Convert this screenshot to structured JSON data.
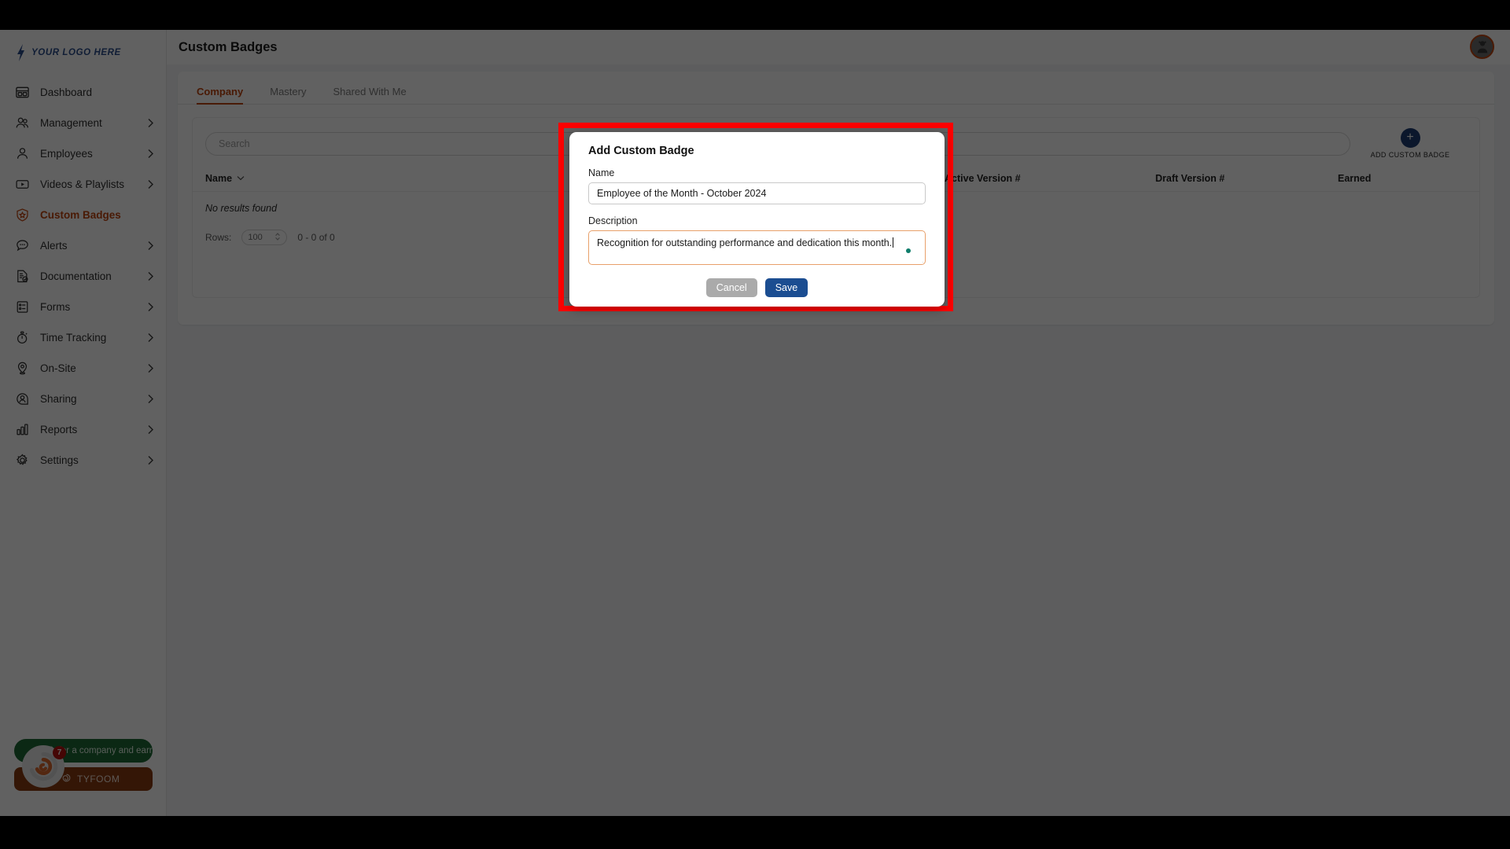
{
  "brand": {
    "logo_text": "YOUR LOGO HERE",
    "accent": "#c1440e",
    "primary_blue": "#1b4d91",
    "logo_blue": "#2b4d8c"
  },
  "sidebar": {
    "items": [
      {
        "label": "Dashboard",
        "icon": "dashboard-icon",
        "chevron": false,
        "active": false
      },
      {
        "label": "Management",
        "icon": "people-icon",
        "chevron": true,
        "active": false
      },
      {
        "label": "Employees",
        "icon": "person-icon",
        "chevron": true,
        "active": false
      },
      {
        "label": "Videos & Playlists",
        "icon": "video-icon",
        "chevron": true,
        "active": false
      },
      {
        "label": "Custom Badges",
        "icon": "badge-shield-icon",
        "chevron": false,
        "active": true
      },
      {
        "label": "Alerts",
        "icon": "chat-bubble-icon",
        "chevron": true,
        "active": false
      },
      {
        "label": "Documentation",
        "icon": "document-check-icon",
        "chevron": true,
        "active": false
      },
      {
        "label": "Forms",
        "icon": "form-list-icon",
        "chevron": true,
        "active": false
      },
      {
        "label": "Time Tracking",
        "icon": "stopwatch-icon",
        "chevron": true,
        "active": false
      },
      {
        "label": "On-Site",
        "icon": "map-pin-icon",
        "chevron": true,
        "active": false
      },
      {
        "label": "Sharing",
        "icon": "share-person-icon",
        "chevron": true,
        "active": false
      },
      {
        "label": "Reports",
        "icon": "bar-chart-icon",
        "chevron": true,
        "active": false
      },
      {
        "label": "Settings",
        "icon": "gear-icon",
        "chevron": true,
        "active": false
      }
    ],
    "promo": {
      "refer_label": "Refer a company and earn $",
      "brand_label": "TYFOOM",
      "notification_count": "7",
      "logo_icon": "tyfoom-spiral-icon"
    }
  },
  "header": {
    "title": "Custom Badges",
    "avatar_icon": "user-avatar-icon"
  },
  "tabs": [
    {
      "label": "Company",
      "active": true
    },
    {
      "label": "Mastery",
      "active": false
    },
    {
      "label": "Shared With Me",
      "active": false
    }
  ],
  "toolbar": {
    "search_placeholder": "Search",
    "search_value": "",
    "search_icon": "search-icon",
    "add_badge_label": "ADD CUSTOM BADGE",
    "add_badge_icon": "plus-icon"
  },
  "table": {
    "columns": [
      "Name",
      "Active Version #",
      "Draft Version #",
      "Earned"
    ],
    "sort_icon": "chevron-down-icon",
    "empty_message": "No results found",
    "rows": [],
    "footer": {
      "rows_label": "Rows:",
      "rows_value": "100",
      "range_text": "0 - 0 of 0"
    }
  },
  "modal": {
    "title": "Add Custom Badge",
    "name_label": "Name",
    "name_value": "Employee of the Month - October 2024",
    "name_placeholder": "",
    "description_label": "Description",
    "description_value": "Recognition for outstanding performance and dedication this month.",
    "description_placeholder": "",
    "cancel_label": "Cancel",
    "save_label": "Save",
    "highlight_color": "#ff0000"
  }
}
